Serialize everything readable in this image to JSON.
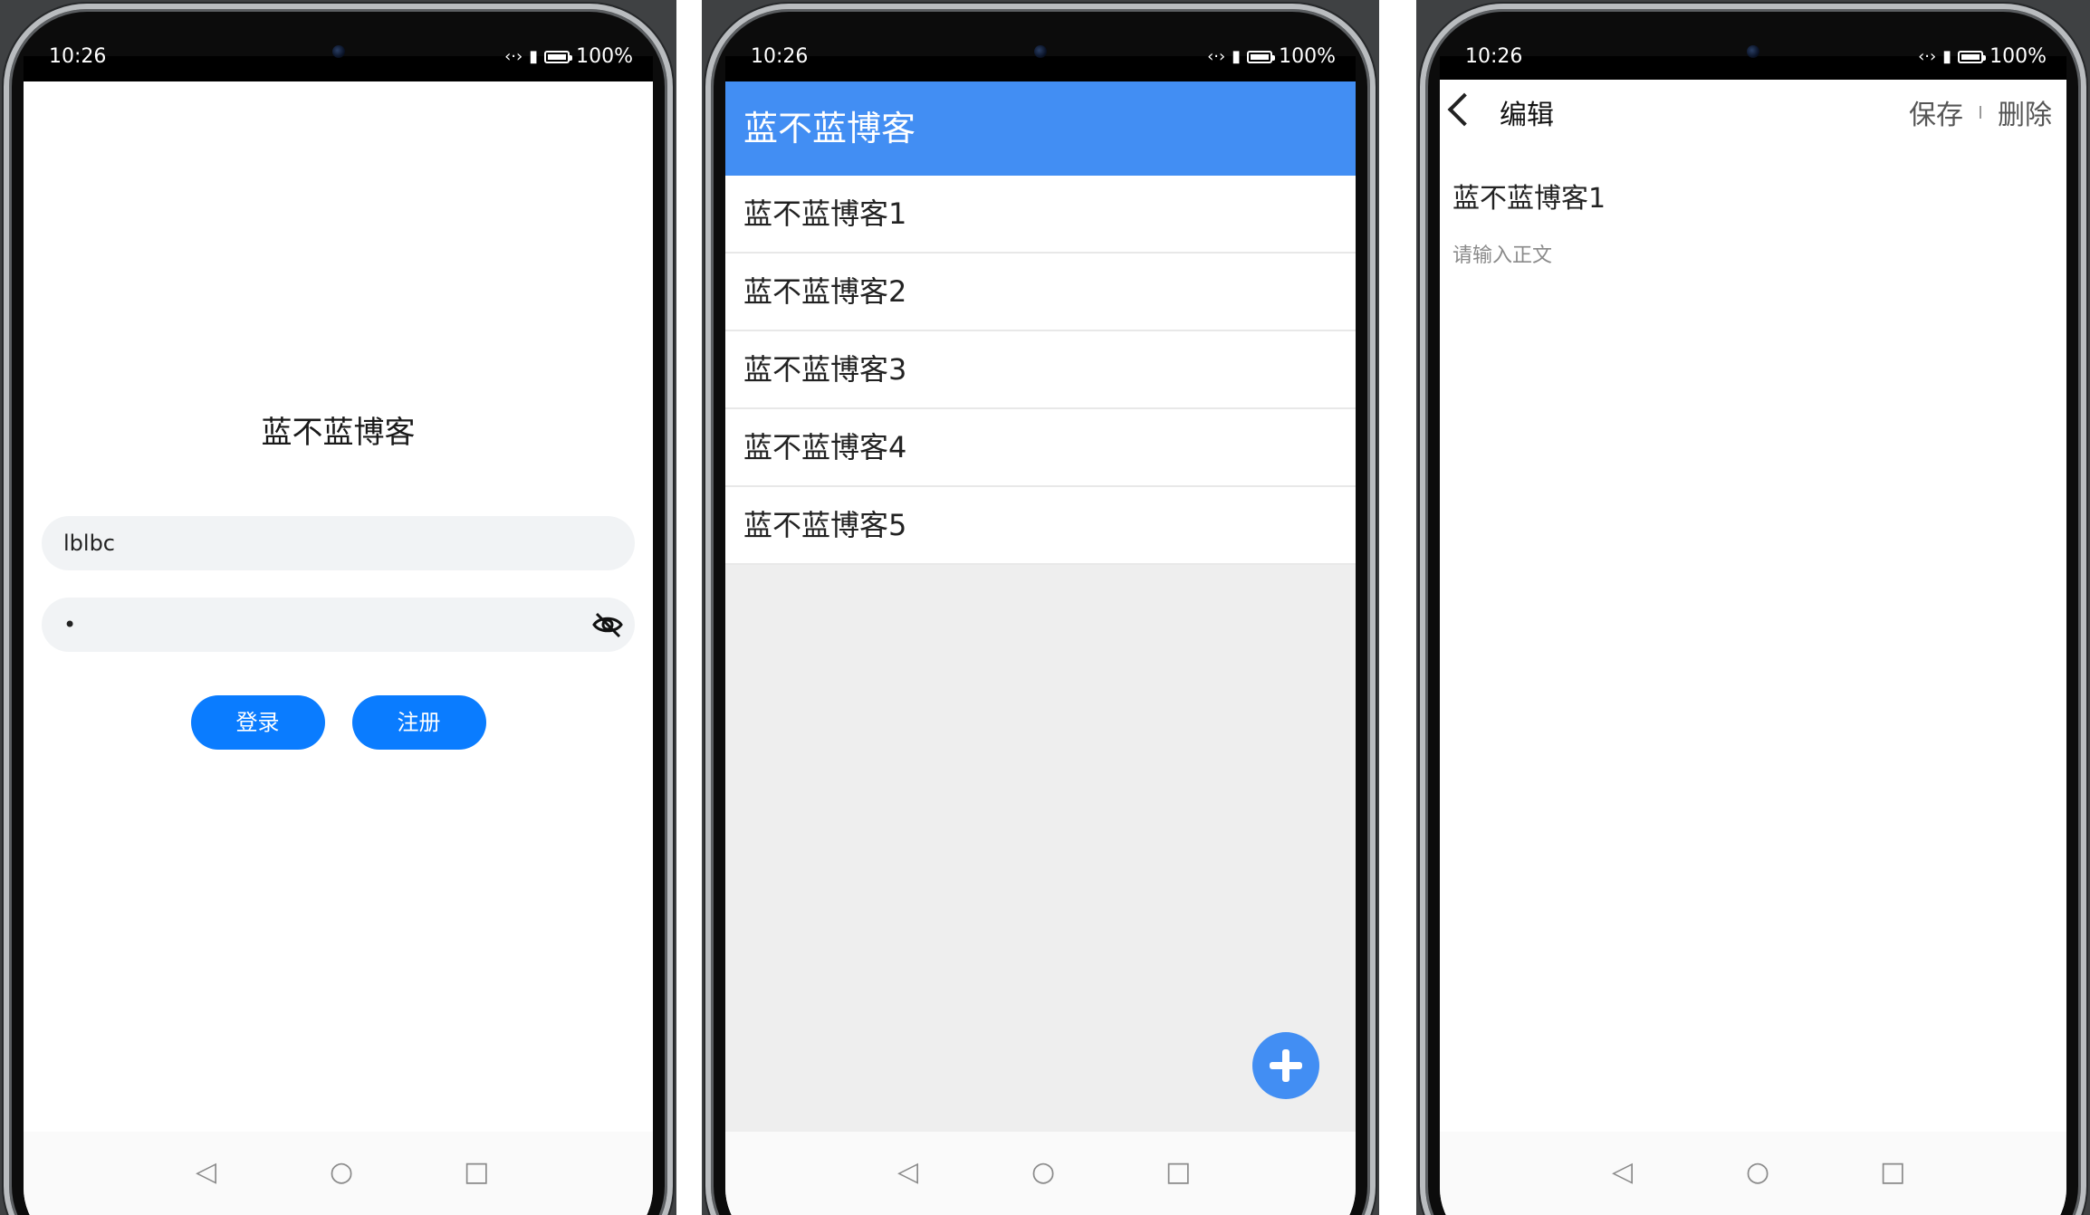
{
  "status": {
    "time": "10:26",
    "battery": "100%",
    "icons": [
      "data-transfer-icon",
      "battery-saver-icon",
      "battery-icon"
    ]
  },
  "login": {
    "title": "蓝不蓝博客",
    "username_value": "lblbc",
    "password_value": "•",
    "login_label": "登录",
    "register_label": "注册",
    "accent": "#0a7cff"
  },
  "list": {
    "header_title": "蓝不蓝博客",
    "items": [
      "蓝不蓝博客1",
      "蓝不蓝博客2",
      "蓝不蓝博客3",
      "蓝不蓝博客4",
      "蓝不蓝博客5"
    ],
    "header_color": "#428ef3"
  },
  "edit": {
    "title": "编辑",
    "save_label": "保存",
    "delete_label": "删除",
    "note_title": "蓝不蓝博客1",
    "body_placeholder": "请输入正文"
  },
  "nav": {
    "back": "◁",
    "home": "○",
    "recent": "□"
  }
}
